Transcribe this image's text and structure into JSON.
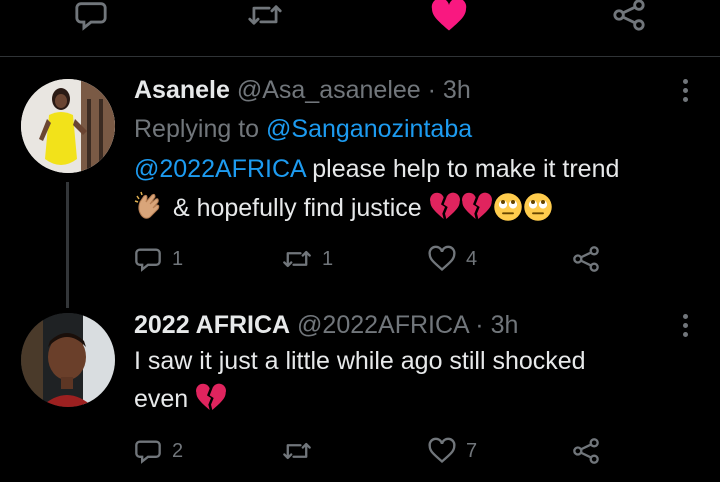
{
  "colors": {
    "background": "#000000",
    "text": "#e7e9ea",
    "muted": "#71767b",
    "link": "#1d9bf0",
    "like_active": "#f91880"
  },
  "top_actions": [
    {
      "icon": "reply-icon"
    },
    {
      "icon": "retweet-icon"
    },
    {
      "icon": "heart-filled-icon",
      "liked": true
    },
    {
      "icon": "share-icon"
    }
  ],
  "tweets": [
    {
      "name": "Asanele",
      "handle": "@Asa_asanelee",
      "separator": "·",
      "time": "3h",
      "replying_prefix": "Replying to",
      "replying_to": "@Sanganozintaba",
      "mention": "@2022AFRICA",
      "line1_rest": " please help to make it trend",
      "line2_text": " & hopefully find justice ",
      "emojis": [
        "clapping-hands-emoji",
        "broken-heart-emoji",
        "broken-heart-emoji",
        "eye-roll-emoji",
        "eye-roll-emoji"
      ],
      "reply_count": "1",
      "retweet_count": "1",
      "like_count": "4"
    },
    {
      "name": "2022 AFRICA",
      "handle": "@2022AFRICA",
      "separator": "·",
      "time": "3h",
      "line1_text": "I saw it just a little while ago still shocked",
      "line2_text": "even ",
      "emojis": [
        "broken-heart-emoji"
      ],
      "reply_count": "2",
      "retweet_count": "",
      "like_count": "7"
    }
  ]
}
